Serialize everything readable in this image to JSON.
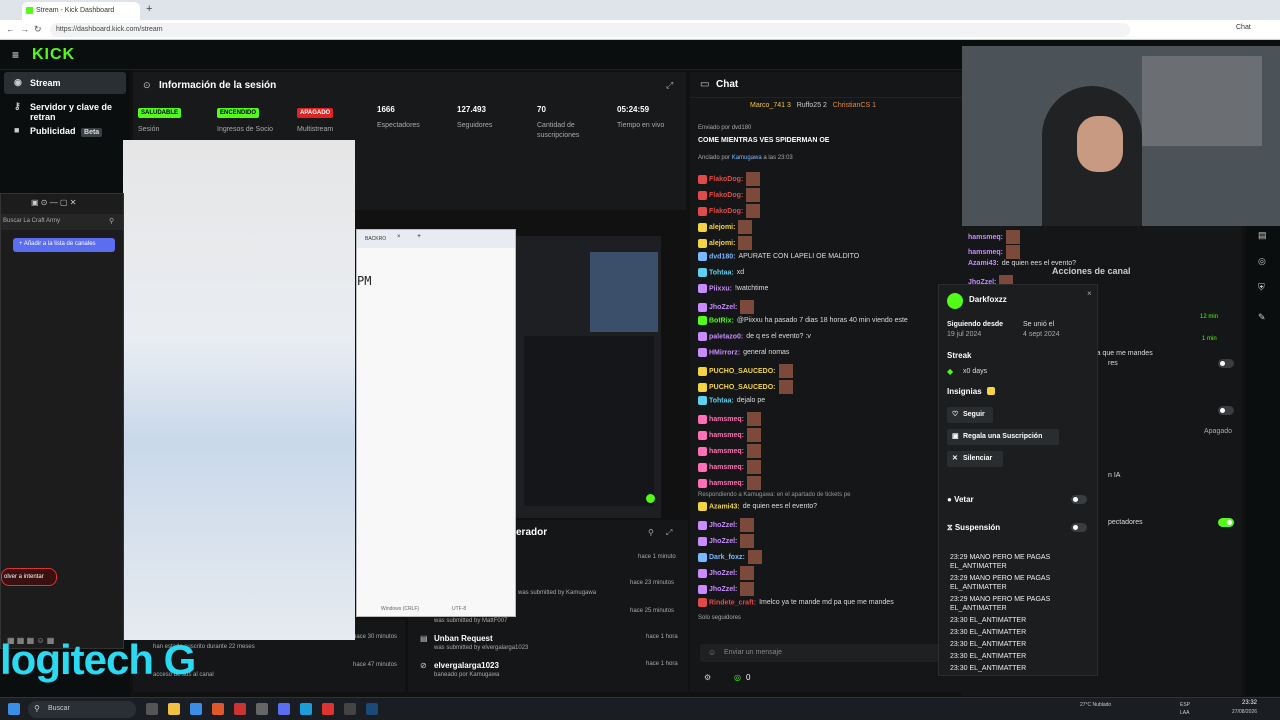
{
  "browser": {
    "tab_title": "Stream - Kick Dashboard",
    "url": "https://dashboard.kick.com/stream",
    "chat_button": "Chat"
  },
  "header": {
    "logo": "KICK"
  },
  "sidebar": {
    "items": [
      {
        "label": "Stream",
        "icon": "stream-icon"
      },
      {
        "label": "Servidor y clave de retran",
        "icon": "key-icon"
      },
      {
        "label": "Publicidad",
        "icon": "ads-icon",
        "badge": "Beta"
      }
    ]
  },
  "session": {
    "title": "Información de la sesión",
    "stats": [
      {
        "badge": "SALUDABLE",
        "badge_color": "#53fc18",
        "label": "Sesión"
      },
      {
        "badge": "ENCENDIDO",
        "badge_color": "#53fc18",
        "label": "Ingresos de Socio"
      },
      {
        "badge": "APAGADO",
        "badge_color": "#e02424",
        "label": "Multistream"
      },
      {
        "value": "1666",
        "label": "Espectadores"
      },
      {
        "value": "127.493",
        "label": "Seguidores"
      },
      {
        "value": "70",
        "label": "Cantidad de suscripciones"
      },
      {
        "value": "05:24:59",
        "label": "Tiempo en vivo"
      }
    ]
  },
  "chat": {
    "title": "Chat",
    "top_gifters": [
      "Marco_741 3",
      "Ruffo25 2",
      "ChristianCS 1"
    ],
    "pinned_by": "Enviado por dvd180",
    "pinned_text": "COME MIENTRAS VES SPIDERMAN OE",
    "pinned_meta": "Anclado por",
    "pinned_user": "Kamugawa",
    "pinned_time": "a las 23:03",
    "messages": [
      {
        "user": "FlakoDog:",
        "color": "#e04a4a",
        "text": ""
      },
      {
        "user": "FlakoDog:",
        "color": "#e04a4a",
        "text": ""
      },
      {
        "user": "FlakoDog:",
        "color": "#e04a4a",
        "text": ""
      },
      {
        "user": "alejomi:",
        "color": "#f5d442",
        "text": ""
      },
      {
        "user": "alejomi:",
        "color": "#f5d442",
        "text": ""
      },
      {
        "user": "dvd180:",
        "color": "#7ab8ff",
        "text": "APURATE CON LAPELI OE MALDITO"
      },
      {
        "user": "Tohtaa:",
        "color": "#5fd1f0",
        "text": "xd"
      },
      {
        "user": "Piixxu:",
        "color": "#c98bff",
        "text": "!watchtime"
      },
      {
        "user": "JhoZzel:",
        "color": "#c98bff",
        "text": ""
      },
      {
        "user": "BotRix:",
        "color": "#53fc18",
        "text": "@Piixxu ha pasado 7 dias 18 horas 40 min viendo este"
      },
      {
        "user": "paletazo0:",
        "color": "#c98bff",
        "text": "de q es el evento? :v"
      },
      {
        "user": "HMirrorz:",
        "color": "#c98bff",
        "text": "general nomas"
      },
      {
        "user": "PUCHO_SAUCEDO:",
        "color": "#f5d442",
        "text": ""
      },
      {
        "user": "PUCHO_SAUCEDO:",
        "color": "#f5d442",
        "text": ""
      },
      {
        "user": "Tohtaa:",
        "color": "#5fd1f0",
        "text": "dejalo pe"
      },
      {
        "user": "hamsmeq:",
        "color": "#ff6fb5",
        "text": ""
      },
      {
        "user": "hamsmeq:",
        "color": "#ff6fb5",
        "text": ""
      },
      {
        "user": "hamsmeq:",
        "color": "#ff6fb5",
        "text": ""
      },
      {
        "user": "hamsmeq:",
        "color": "#ff6fb5",
        "text": ""
      },
      {
        "user": "hamsmeq:",
        "color": "#ff6fb5",
        "text": ""
      }
    ],
    "reply_note": "Respondiendo a Kamugawa: en el apartado de tickets pe",
    "messages2": [
      {
        "user": "Azami43:",
        "color": "#f5d442",
        "text": "de quien ees el evento?"
      },
      {
        "user": "JhoZzel:",
        "color": "#c98bff",
        "text": ""
      },
      {
        "user": "JhoZzel:",
        "color": "#c98bff",
        "text": ""
      },
      {
        "user": "Dark_foxz:",
        "color": "#7ab8ff",
        "text": ""
      },
      {
        "user": "JhoZzel:",
        "color": "#c98bff",
        "text": ""
      },
      {
        "user": "JhoZzel:",
        "color": "#c98bff",
        "text": ""
      },
      {
        "user": "Rindete_craft:",
        "color": "#e04a4a",
        "text": "Imelco ya te mande md pa que me mandes"
      }
    ],
    "followers_only": "Solo seguidores",
    "input_placeholder": "Enviar un mensaje",
    "bottom_count": "0"
  },
  "usercard": {
    "username": "Darkfoxzz",
    "following_since_label": "Siguiendo desde",
    "following_since": "19 jul 2024",
    "joined_label": "Se unió el",
    "joined": "4 sept 2024",
    "streak_label": "Streak",
    "streak": "x0 days",
    "badges_label": "Insignias",
    "follow": "Seguir",
    "gift": "Regala una Suscripción",
    "mute": "Silenciar",
    "veto": "Vetar",
    "suspension": "Suspensión",
    "log": [
      "23:29 MANO PERO ME PAGAS EL_ANTIMATTER",
      "23:29 MANO PERO ME PAGAS EL_ANTIMATTER",
      "23:29 MANO PERO ME PAGAS EL_ANTIMATTER",
      "23:30 EL_ANTIMATTER",
      "23:30 EL_ANTIMATTER",
      "23:30 EL_ANTIMATTER",
      "23:30 EL_ANTIMATTER",
      "23:30 EL_ANTIMATTER"
    ]
  },
  "overlay_chat": [
    {
      "user": "hamsmeq:",
      "text": ""
    },
    {
      "user": "hamsmeq:",
      "text": ""
    },
    {
      "user": "Azami43:",
      "text": "de quien ees el evento?"
    },
    {
      "user": "JhoZzel:",
      "text": ""
    },
    {
      "user": "JhoZzel:",
      "text": ""
    },
    {
      "user": "Darkfoxzz:",
      "text": ""
    },
    {
      "user": "JhoZzel:",
      "text": ""
    },
    {
      "user": "JhoZzel:",
      "text": ""
    },
    {
      "user": "Rindete_craft:",
      "text": "Imelco ya te mande md pa que me mandes"
    }
  ],
  "actions": {
    "title": "Acciones de canal",
    "time1": "12 min",
    "time2": "1 min",
    "row_res": "res",
    "apagado": "Apagado",
    "ia": "n IA",
    "espectadores": "pectadores"
  },
  "left_window": {
    "search_placeholder": "Buscar La Craft Army",
    "add_button": "Añadir a la lista de canales",
    "retry": "olver a intentar"
  },
  "notepad": {
    "tab": "BACKRO",
    "text": "PM",
    "encoding_left": "Windows (CRLF)",
    "encoding_right": "UTF-8"
  },
  "moderation": {
    "title": "erador",
    "rows": [
      {
        "time": "hace 1 minuto"
      },
      {
        "time": "hace 23 minutos",
        "sub": "was submitted by Kamugawa"
      },
      {
        "time": "hace 25 minutos",
        "sub": "was submitted by MattF007"
      },
      {
        "title": "Unban Request",
        "time": "hace 1 hora",
        "sub": "was submitted by elvergalarga1023"
      },
      {
        "title": "elvergalarga1023",
        "time": "hace 1 hora",
        "sub": "baneado por Kamugawa"
      }
    ],
    "left_rows": [
      {
        "time": "hace 30 minutos",
        "text": "han estado suscrito durante 22 meses"
      },
      {
        "time": "hace 47 minutos",
        "text": "acceso de sus al canal"
      }
    ]
  },
  "logo_overlay": "logitech G",
  "taskbar": {
    "search": "Buscar",
    "weather": "27°C Nublado",
    "lang": "ESP LAA",
    "time": "23:32",
    "date": "27/08/2026"
  }
}
